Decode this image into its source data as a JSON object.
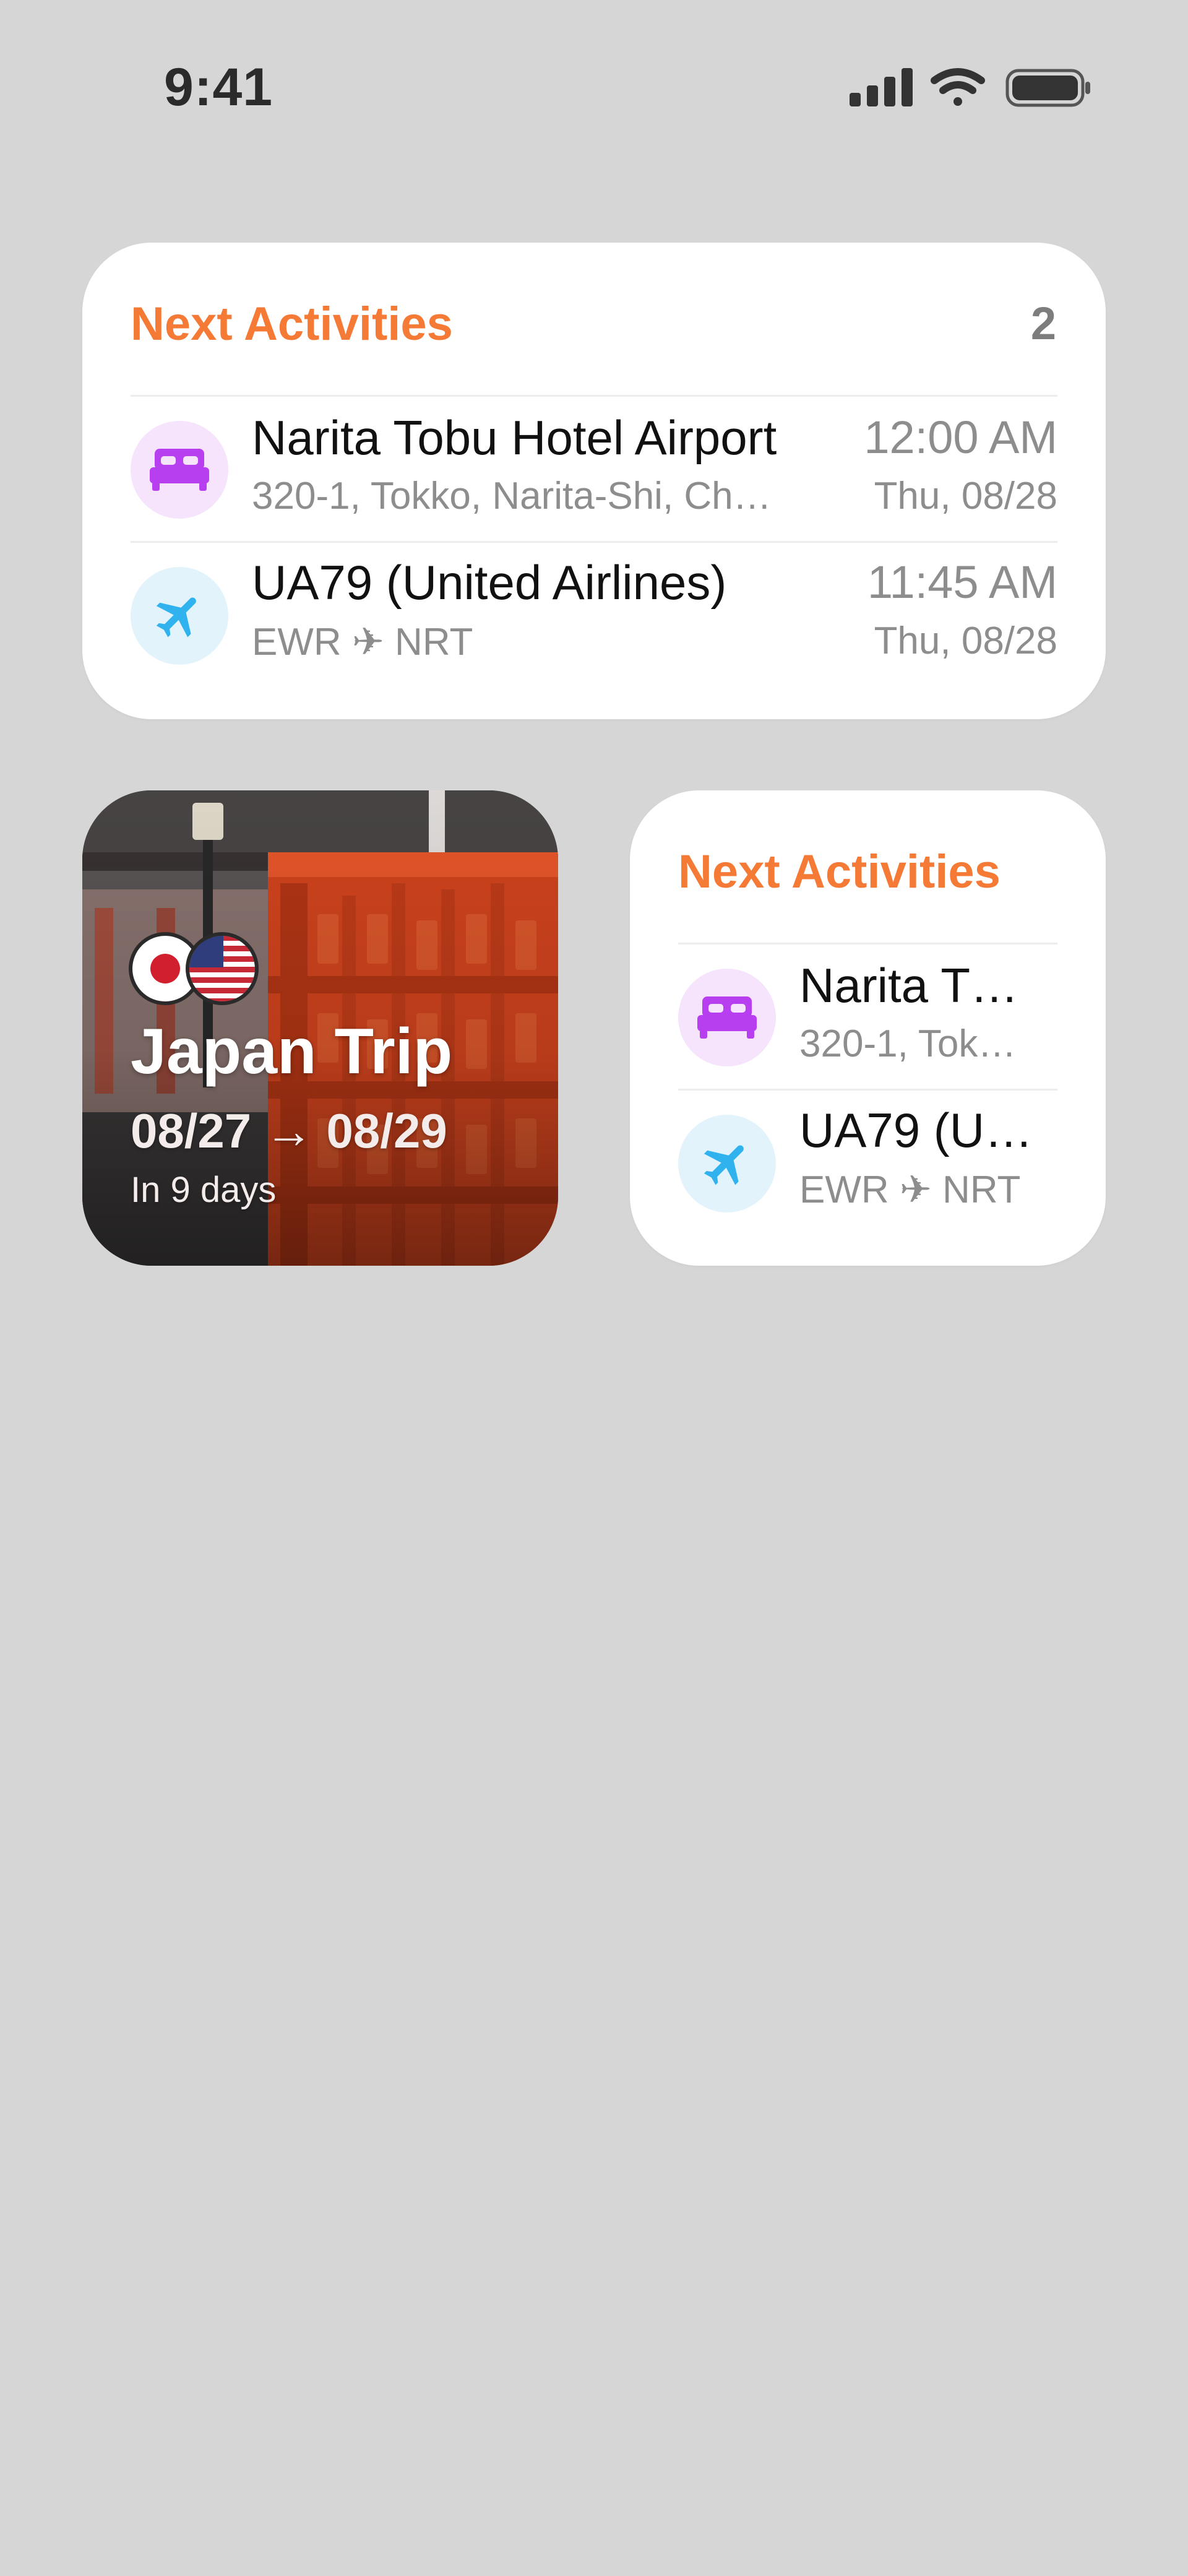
{
  "status_bar": {
    "time": "9:41",
    "icons": [
      "signal-icon",
      "wifi-icon",
      "battery-icon"
    ]
  },
  "large_widget": {
    "title": "Next Activities",
    "count": "2",
    "items": [
      {
        "icon": "bed-icon",
        "title": "Narita Tobu Hotel Airport",
        "subtitle": "320-1, Tokko, Narita-Shi, Ch…",
        "time": "12:00 AM",
        "date": "Thu, 08/28"
      },
      {
        "icon": "airplane-icon",
        "title": "UA79 (United Airlines)",
        "subtitle": "EWR ✈ NRT",
        "time": "11:45 AM",
        "date": "Thu, 08/28"
      }
    ]
  },
  "trip_widget": {
    "title": "Japan Trip",
    "dates": "08/27 → 08/29",
    "countdown": "In 9 days",
    "flags": [
      "japan-flag-icon",
      "usa-flag-icon"
    ]
  },
  "small_widget": {
    "title": "Next Activities",
    "items": [
      {
        "icon": "bed-icon",
        "title": "Narita T…",
        "subtitle": "320-1, Tok…"
      },
      {
        "icon": "airplane-icon",
        "title": "UA79 (U…",
        "subtitle": "EWR ✈ NRT"
      }
    ]
  },
  "colors": {
    "background": "#d6d6d6",
    "accent": "#f47a36",
    "hotel_icon": "#b73ff0",
    "flight_icon": "#2fb2ee"
  }
}
